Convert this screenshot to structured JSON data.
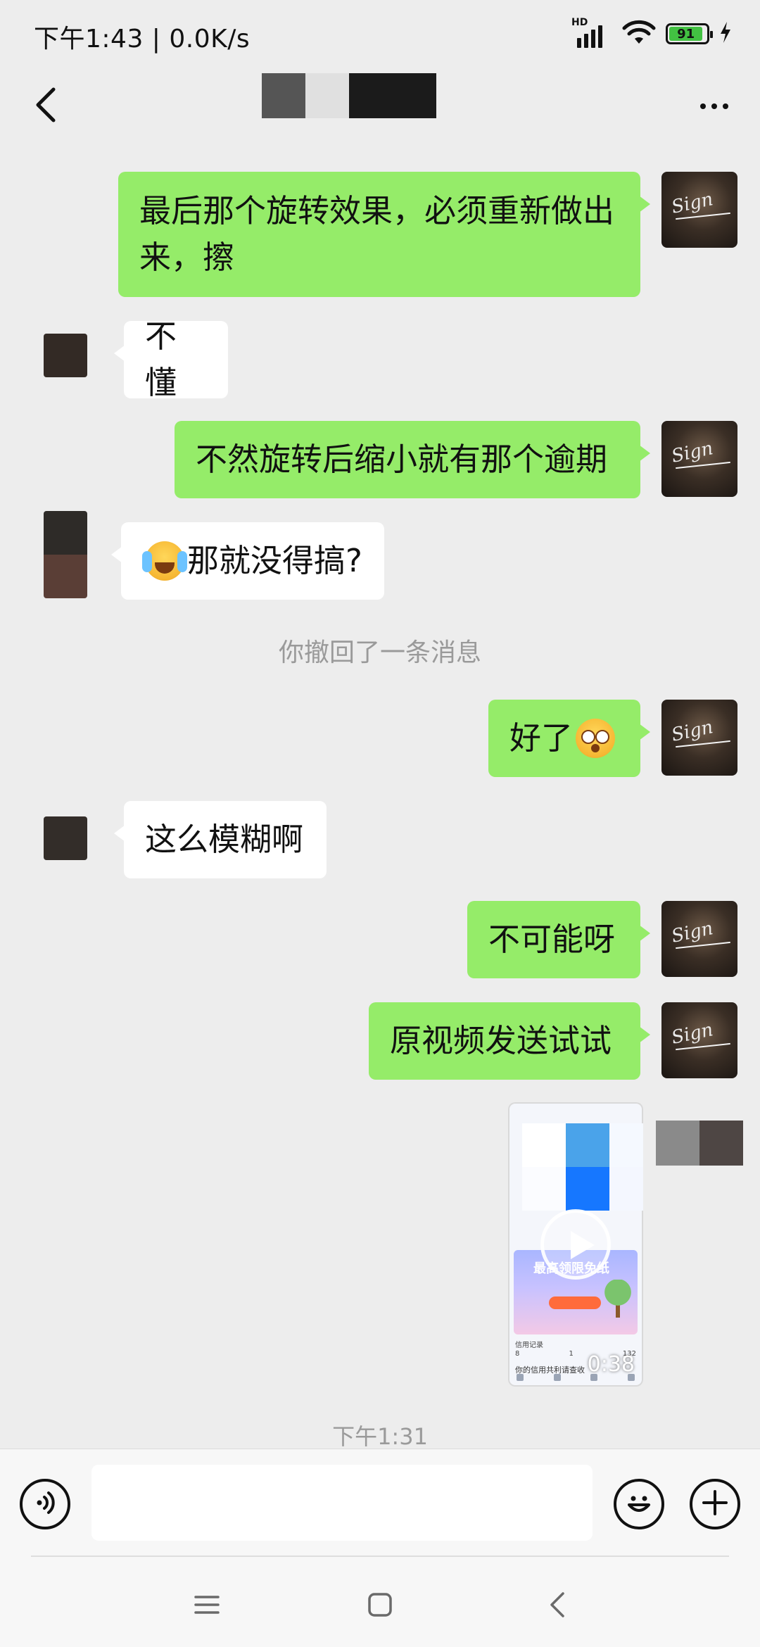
{
  "status_bar": {
    "time_speed": "下午1:43 | 0.0K/s",
    "network_badge": "HD",
    "battery_level": "91"
  },
  "header": {
    "title_blurred": true,
    "back_icon": "chevron-left-icon",
    "more_icon": "more-dots-icon"
  },
  "messages": [
    {
      "sender": "me",
      "text_line1": "最后那个旋转效果，必须重新做出",
      "text_line2": "来，擦"
    },
    {
      "sender": "other",
      "text": "不懂"
    },
    {
      "sender": "me",
      "text": "不然旋转后缩小就有那个逾期"
    },
    {
      "sender": "other",
      "text": "那就没得搞?",
      "emoji": "crying-face"
    },
    {
      "sender": "system",
      "text": "你撤回了一条消息"
    },
    {
      "sender": "me",
      "text": "好了",
      "emoji": "astonished-face"
    },
    {
      "sender": "other",
      "text": "这么模糊啊"
    },
    {
      "sender": "me",
      "text": "不可能呀"
    },
    {
      "sender": "me",
      "text": "原视频发送试试"
    },
    {
      "sender": "me",
      "type": "video",
      "duration": "0:38",
      "thumb_title": "最高领限免纸",
      "thumb_record_label": "信用记录",
      "thumb_nums": [
        "8",
        "1",
        "132"
      ],
      "thumb_footer": "你的信用共利请查收"
    }
  ],
  "timestamp_divider": "下午1:31",
  "input_bar": {
    "voice_icon": "voice-icon",
    "emoji_icon": "smiley-icon",
    "plus_icon": "plus-circle-icon",
    "input_value": ""
  },
  "system_nav": {
    "menu_icon": "menu-icon",
    "home_icon": "home-square-icon",
    "back_icon": "back-triangle-icon"
  },
  "colors": {
    "chat_bg": "#ededed",
    "my_bubble": "#95ec69",
    "their_bubble": "#ffffff",
    "system_text": "#9a9a9a",
    "battery_fill": "#42c142"
  }
}
